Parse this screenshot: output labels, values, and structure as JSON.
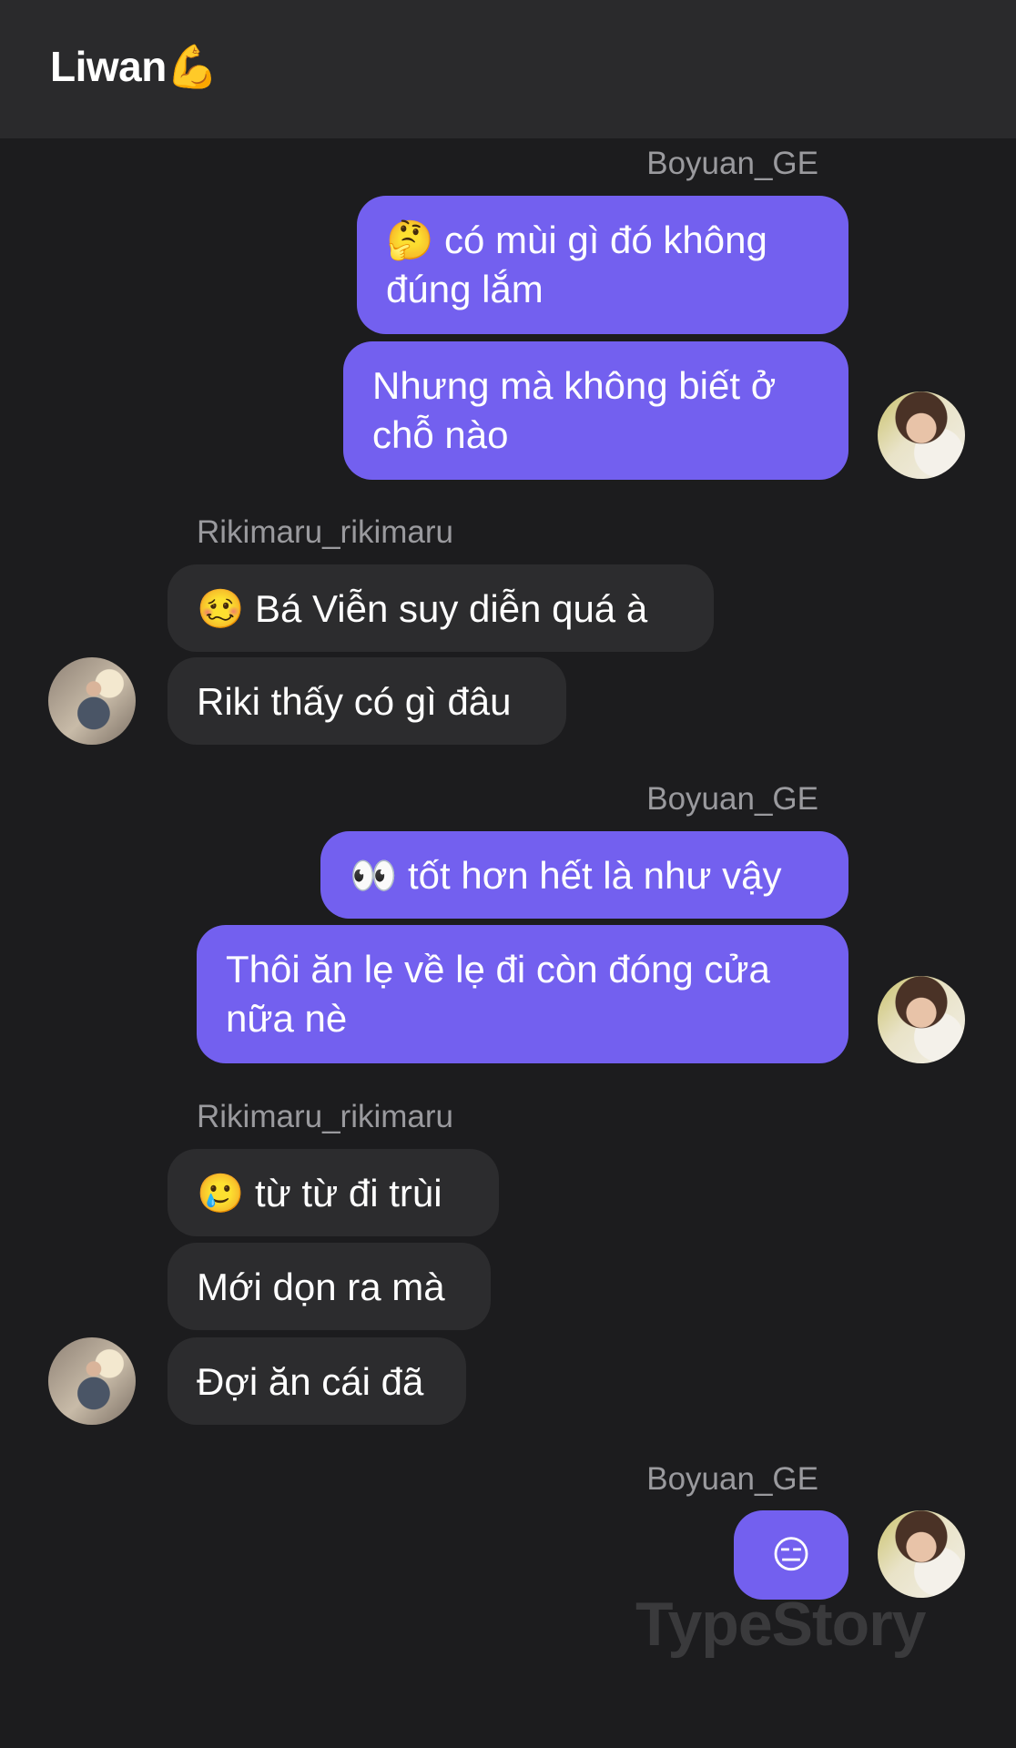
{
  "header": {
    "title": "Liwan",
    "title_emoji": "💪"
  },
  "messages": [
    {
      "sender": "Boyuan_GE",
      "bubbles": [
        "🤔 có mùi gì đó không đúng lắm",
        "Nhưng mà không biết ở chỗ nào"
      ]
    },
    {
      "sender": "Rikimaru_rikimaru",
      "bubbles": [
        "🥴 Bá Viễn suy diễn quá à",
        "Riki thấy có gì đâu"
      ]
    },
    {
      "sender": "Boyuan_GE",
      "bubbles": [
        "👀 tốt hơn hết là như vậy",
        "Thôi ăn lẹ về lẹ đi còn đóng cửa nữa nè"
      ]
    },
    {
      "sender": "Rikimaru_rikimaru",
      "bubbles": [
        "🥲 từ từ đi trùi",
        "Mới dọn ra mà",
        "Đợi ăn cái đã"
      ]
    },
    {
      "sender": "Boyuan_GE",
      "bubbles": [
        "😑"
      ]
    }
  ],
  "watermark": "TypeStory",
  "colors": {
    "outgoing": "#7360ef",
    "incoming": "#2c2c2e",
    "background": "#1c1c1e",
    "header": "#2a2a2c"
  }
}
